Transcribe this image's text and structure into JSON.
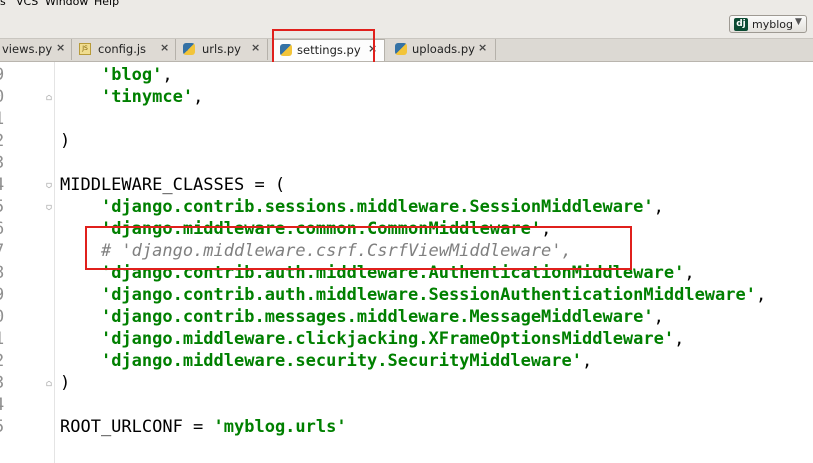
{
  "menubar": {
    "items": [
      "s",
      "VCS",
      "Window",
      "Help"
    ]
  },
  "toolbar": {
    "run_config": {
      "icon": "django-icon",
      "label": "myblog"
    }
  },
  "tabs": [
    {
      "label": "views.py",
      "icon": "python-file-icon",
      "active": false
    },
    {
      "label": "config.js",
      "icon": "js-file-icon",
      "active": false
    },
    {
      "label": "urls.py",
      "icon": "python-file-icon",
      "active": false
    },
    {
      "label": "settings.py",
      "icon": "python-file-icon",
      "active": true
    },
    {
      "label": "uploads.py",
      "icon": "python-file-icon",
      "active": false
    }
  ],
  "editor": {
    "line_numbers": [
      "9",
      "0",
      "1",
      "2",
      "3",
      "4",
      "5",
      "6",
      "7",
      "8",
      "9",
      "0",
      "1",
      "2",
      "3",
      "4",
      "5"
    ],
    "lines": [
      {
        "segments": [
          {
            "t": "    "
          },
          {
            "t": "'blog'",
            "c": "str"
          },
          {
            "t": ","
          }
        ]
      },
      {
        "segments": [
          {
            "t": "    "
          },
          {
            "t": "'tinymce'",
            "c": "str"
          },
          {
            "t": ","
          }
        ]
      },
      {
        "segments": []
      },
      {
        "segments": [
          {
            "t": ")"
          }
        ]
      },
      {
        "segments": []
      },
      {
        "segments": [
          {
            "t": "MIDDLEWARE_CLASSES = ("
          }
        ]
      },
      {
        "segments": [
          {
            "t": "    "
          },
          {
            "t": "'django.contrib.sessions.middleware.SessionMiddleware'",
            "c": "str"
          },
          {
            "t": ","
          }
        ]
      },
      {
        "segments": [
          {
            "t": "    "
          },
          {
            "t": "'django.middleware.common.CommonMiddleware'",
            "c": "str"
          },
          {
            "t": ","
          }
        ]
      },
      {
        "segments": [
          {
            "t": "    "
          },
          {
            "t": "# 'django.middleware.csrf.CsrfViewMiddleware',",
            "c": "cmt"
          }
        ]
      },
      {
        "segments": [
          {
            "t": "    "
          },
          {
            "t": "'django.contrib.auth.middleware.AuthenticationMiddleware'",
            "c": "str"
          },
          {
            "t": ","
          }
        ]
      },
      {
        "segments": [
          {
            "t": "    "
          },
          {
            "t": "'django.contrib.auth.middleware.SessionAuthenticationMiddleware'",
            "c": "str"
          },
          {
            "t": ","
          }
        ]
      },
      {
        "segments": [
          {
            "t": "    "
          },
          {
            "t": "'django.contrib.messages.middleware.MessageMiddleware'",
            "c": "str"
          },
          {
            "t": ","
          }
        ]
      },
      {
        "segments": [
          {
            "t": "    "
          },
          {
            "t": "'django.middleware.clickjacking.XFrameOptionsMiddleware'",
            "c": "str"
          },
          {
            "t": ","
          }
        ]
      },
      {
        "segments": [
          {
            "t": "    "
          },
          {
            "t": "'django.middleware.security.SecurityMiddleware'",
            "c": "str"
          },
          {
            "t": ","
          }
        ]
      },
      {
        "segments": [
          {
            "t": ")"
          }
        ]
      },
      {
        "segments": []
      },
      {
        "segments": [
          {
            "t": "ROOT_URLCONF = "
          },
          {
            "t": "'myblog.urls'",
            "c": "str"
          }
        ]
      }
    ]
  },
  "colors": {
    "highlight": "#e0201c",
    "string": "#008000",
    "comment": "#808080"
  }
}
